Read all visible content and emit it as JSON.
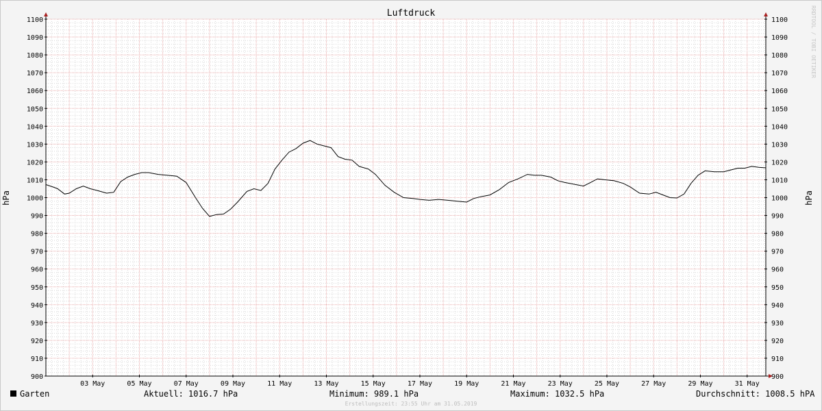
{
  "colors": {
    "background": "#f4f4f4",
    "plot_bg": "#ffffff",
    "major_grid": "#e8a8a8",
    "minor_grid": "#d6d6d6",
    "series": "#000000",
    "axis_arrow": "#aa2222"
  },
  "watermark": "RRDTOOL / TOBI OETIKER",
  "footer": "Erstellungszeit: 23:55 Uhr am 31.05.2019",
  "legend": {
    "series_name": "Garten",
    "current": "Aktuell: 1016.7 hPa",
    "minimum": "Minimum: 989.1 hPa",
    "maximum": "Maximum: 1032.5 hPa",
    "average": "Durchschnitt: 1008.5 hPA"
  },
  "chart_data": {
    "type": "line",
    "title": "Luftdruck",
    "ylabel": "hPa",
    "ylabel_right": "hPa",
    "ylim": [
      900,
      1100
    ],
    "yticks": [
      900,
      910,
      920,
      930,
      940,
      950,
      960,
      970,
      980,
      990,
      1000,
      1010,
      1020,
      1030,
      1040,
      1050,
      1060,
      1070,
      1080,
      1090,
      1100
    ],
    "x_day_range": [
      1,
      31.8
    ],
    "xtick_days": [
      3,
      5,
      7,
      9,
      11,
      13,
      15,
      17,
      19,
      21,
      23,
      25,
      27,
      29,
      31
    ],
    "xtick_labels": [
      "03 May",
      "05 May",
      "07 May",
      "09 May",
      "11 May",
      "13 May",
      "15 May",
      "17 May",
      "19 May",
      "21 May",
      "23 May",
      "25 May",
      "27 May",
      "29 May",
      "31 May"
    ],
    "grid": true,
    "series": [
      {
        "name": "Garten",
        "x": [
          1.0,
          1.3,
          1.5,
          1.8,
          2.0,
          2.3,
          2.6,
          2.9,
          3.2,
          3.6,
          3.9,
          4.2,
          4.5,
          4.8,
          5.1,
          5.4,
          5.8,
          6.2,
          6.6,
          7.0,
          7.4,
          7.7,
          8.0,
          8.3,
          8.6,
          8.9,
          9.2,
          9.6,
          9.9,
          10.2,
          10.5,
          10.8,
          11.1,
          11.4,
          11.7,
          12.0,
          12.3,
          12.6,
          12.9,
          13.2,
          13.5,
          13.8,
          14.1,
          14.4,
          14.8,
          15.1,
          15.5,
          15.9,
          16.3,
          16.7,
          17.0,
          17.4,
          17.8,
          18.2,
          18.6,
          19.0,
          19.3,
          19.6,
          20.0,
          20.4,
          20.8,
          21.2,
          21.6,
          21.9,
          22.2,
          22.6,
          22.9,
          23.2,
          23.6,
          24.0,
          24.3,
          24.6,
          24.9,
          25.3,
          25.7,
          26.0,
          26.4,
          26.8,
          27.1,
          27.4,
          27.7,
          28.0,
          28.3,
          28.6,
          28.9,
          29.2,
          29.6,
          30.0,
          30.3,
          30.6,
          30.9,
          31.2,
          31.5,
          31.8
        ],
        "y": [
          1007.3,
          1006.0,
          1005.0,
          1002.0,
          1002.5,
          1005.0,
          1006.5,
          1005.0,
          1004.0,
          1002.5,
          1003.0,
          1009.0,
          1011.5,
          1013.0,
          1014.0,
          1014.0,
          1013.0,
          1012.5,
          1012.0,
          1008.5,
          1000.0,
          994.0,
          989.5,
          990.5,
          990.8,
          993.5,
          997.5,
          1003.5,
          1005.0,
          1004.0,
          1008.0,
          1016.0,
          1021.0,
          1025.5,
          1027.5,
          1030.5,
          1032.0,
          1030.0,
          1029.0,
          1028.0,
          1023.0,
          1021.5,
          1021.0,
          1017.5,
          1016.0,
          1013.0,
          1007.0,
          1003.0,
          1000.0,
          999.5,
          999.0,
          998.5,
          999.0,
          998.5,
          998.0,
          997.5,
          999.5,
          1000.5,
          1001.5,
          1004.5,
          1008.5,
          1010.5,
          1013.0,
          1012.5,
          1012.5,
          1011.5,
          1009.5,
          1008.5,
          1007.5,
          1006.5,
          1008.5,
          1010.5,
          1010.0,
          1009.5,
          1008.0,
          1006.0,
          1002.5,
          1002.0,
          1003.0,
          1001.5,
          1000.0,
          999.8,
          1002.0,
          1008.0,
          1012.5,
          1015.0,
          1014.5,
          1014.5,
          1015.5,
          1016.5,
          1016.5,
          1017.5,
          1017.0,
          1016.7
        ]
      }
    ]
  }
}
